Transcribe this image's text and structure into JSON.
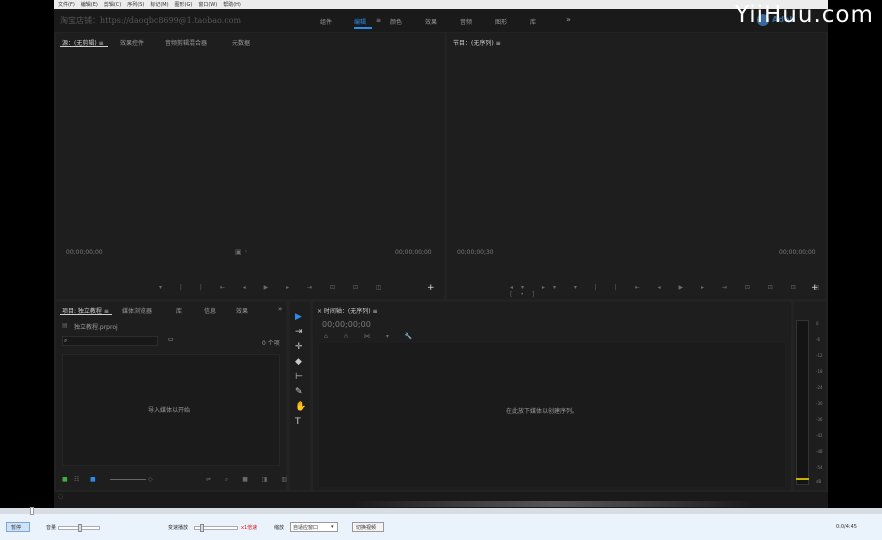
{
  "menu": [
    "文件(F)",
    "编辑(E)",
    "剪辑(C)",
    "序列(S)",
    "标记(M)",
    "图形(G)",
    "窗口(W)",
    "帮助(H)"
  ],
  "shop_text": "淘宝店铺：https://daoqbc8699@1.taobao.com",
  "workspaces": [
    "组件",
    "编辑",
    "颜色",
    "效果",
    "音频",
    "图形",
    "库",
    "»"
  ],
  "workspace_active_menu": "≡",
  "adobe_label": "Adob",
  "watermark": "YiiHuu.com",
  "source": {
    "tabs": [
      "源：(无剪辑) ≡",
      "效果控件",
      "音频剪辑混合器",
      "元数据"
    ],
    "tc_left": "00;00;00;00",
    "tc_right": "00;00;00;00"
  },
  "program": {
    "tab": "节目：(无序列) ≡",
    "tc_left": "00;00;00;30",
    "tc_right": "00;00;00;00"
  },
  "project": {
    "tabs": [
      "项目: 独立教程 ≡",
      "媒体浏览器",
      "库",
      "信息",
      "效果",
      "»"
    ],
    "file_name": "独立教程.prproj",
    "items_count": "0 个项",
    "empty_hint": "导入媒体以开始"
  },
  "timeline": {
    "tab": "× 时间轴：(无序列) ≡",
    "tc": "00;00;00;00",
    "empty_hint": "在此放下媒体以创建序列。"
  },
  "vu_scale": [
    "0",
    "-6",
    "-12",
    "-18",
    "-24",
    "-30",
    "-36",
    "-42",
    "-48",
    "-54",
    "dB"
  ],
  "player": {
    "pause_label": "暂停",
    "volume_label": "音量",
    "speed_label": "变速播放",
    "speed_value": "x1倍速",
    "zoom_label": "缩放",
    "zoom_value": "自适应窗口",
    "switch_label": "切换视频",
    "time": "0:0/4:45"
  }
}
